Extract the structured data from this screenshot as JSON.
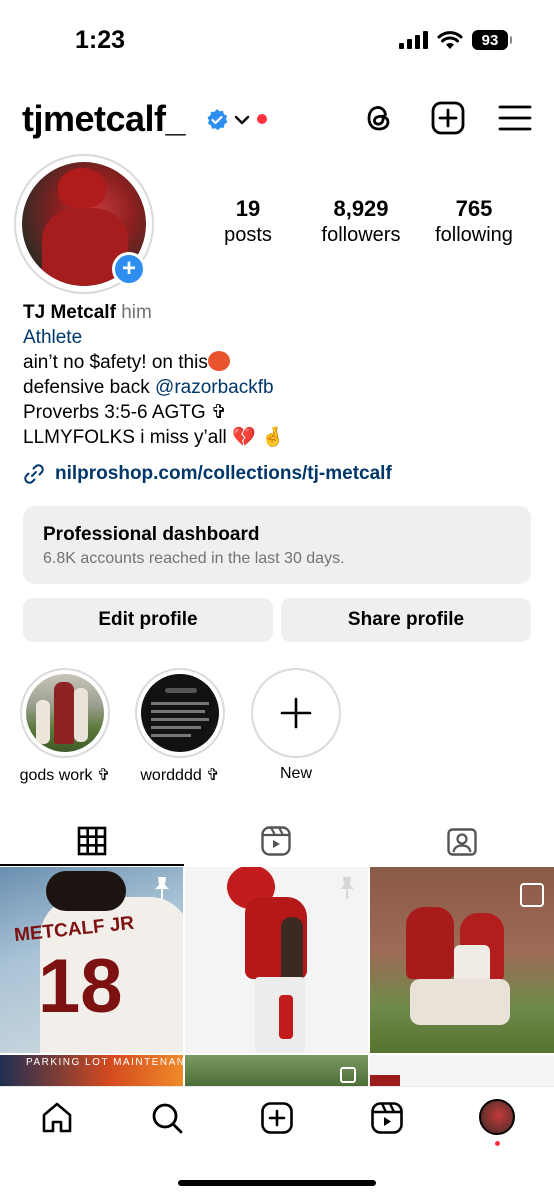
{
  "status_bar": {
    "time": "1:23",
    "battery": "93"
  },
  "header": {
    "username": "tjmetcalf_",
    "icons": [
      "verified-badge-icon",
      "chevron-down-icon",
      "threads-icon",
      "create-post-icon",
      "menu-icon"
    ]
  },
  "profile": {
    "stats": [
      {
        "value": "19",
        "label": "posts"
      },
      {
        "value": "8,929",
        "label": "followers"
      },
      {
        "value": "765",
        "label": "following"
      }
    ],
    "name": "TJ Metcalf",
    "pronouns": "him",
    "category": "Athlete",
    "bio_line1": "ain’t no $afety! on this",
    "bio_line2_prefix": "defensive back ",
    "bio_line2_mention": "@razorbackfb",
    "bio_line3": "Proverbs 3:5-6 AGTG ✞",
    "bio_line4": "LLMYFOLKS i miss y’all",
    "link": "nilproshop.com/collections/tj-metcalf"
  },
  "dashboard": {
    "title": "Professional dashboard",
    "subtitle": "6.8K accounts reached in the last 30 days."
  },
  "buttons": {
    "edit": "Edit profile",
    "share": "Share profile"
  },
  "highlights": [
    {
      "label": "gods work ✞"
    },
    {
      "label": "wordddd ✞"
    },
    {
      "label": "New"
    }
  ],
  "grid": {
    "post1_name": "METCALF JR",
    "post1_number": "18",
    "post4_banner": "PARKING LOT MAINTENANCE"
  },
  "colors": {
    "link": "#00376b",
    "badge_blue": "#2d8ef0",
    "notify_red": "#ff3040",
    "button_bg": "#efefef"
  }
}
